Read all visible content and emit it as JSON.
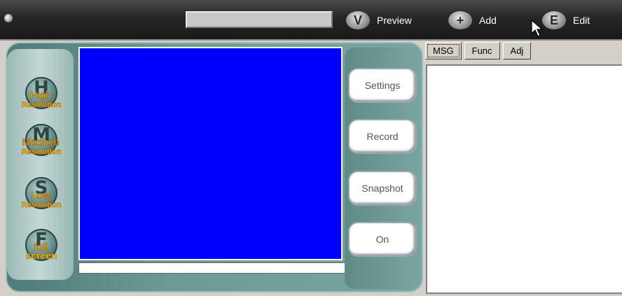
{
  "toolbar": {
    "title_field_value": "",
    "preview_label": "Preview",
    "add_label": "Add",
    "edit_label": "Edit",
    "preview_icon": "V",
    "add_icon": "+",
    "edit_icon": "E"
  },
  "resolution_buttons": [
    {
      "letter": "H",
      "line1": "High",
      "line2": "Resolution"
    },
    {
      "letter": "M",
      "line1": "Medium",
      "line2": "Resolution"
    },
    {
      "letter": "S",
      "line1": "Low",
      "line2": "Resolution"
    },
    {
      "letter": "F",
      "line1": "full",
      "line2": "screen"
    }
  ],
  "actions": {
    "settings": "Settings",
    "record": "Record",
    "snapshot": "Snapshot",
    "on": "On"
  },
  "tabs": [
    "MSG",
    "Func",
    "Adj"
  ],
  "colors": {
    "video_bg": "#0000ff",
    "panel_teal": "#6d9a96",
    "label_yellow": "#ffd200"
  }
}
